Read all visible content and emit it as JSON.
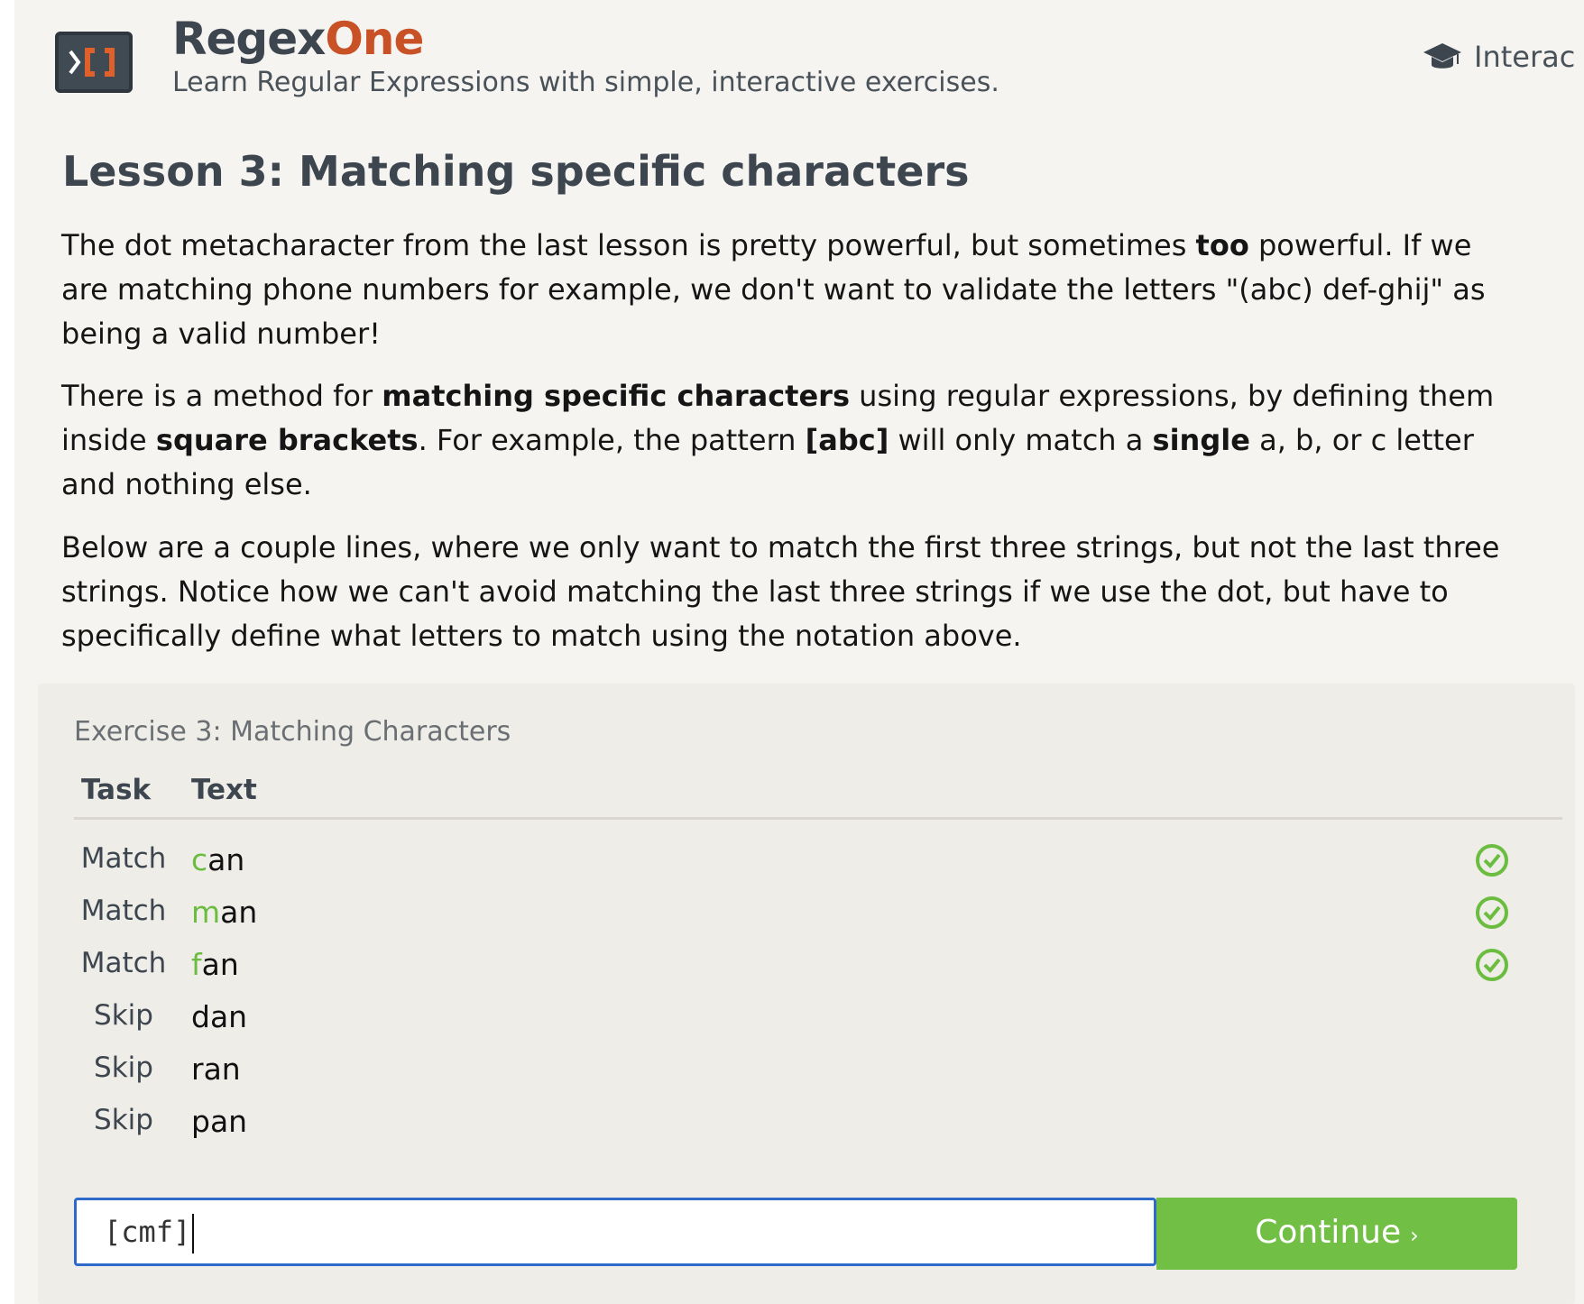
{
  "header": {
    "brand_part1": "Regex",
    "brand_part2": "One",
    "tagline": "Learn Regular Expressions with simple, interactive exercises.",
    "nav_link": "Interac",
    "logo_icon": "regex-bracket-logo",
    "nav_icon": "graduation-cap-icon"
  },
  "lesson": {
    "title": "Lesson 3: Matching specific characters",
    "p1": {
      "a": "The dot metacharacter from the last lesson is pretty powerful, but sometimes ",
      "b": "too",
      "c": " powerful. If we are matching phone numbers for example, we don't want to validate the letters \"(abc) def-ghij\" as being a valid number!"
    },
    "p2": {
      "a": "There is a method for ",
      "b": "matching specific characters",
      "c": " using regular expressions, by defining them inside ",
      "d": "square brackets",
      "e": ". For example, the pattern ",
      "f": "[abc]",
      "g": " will only match a ",
      "h": "single",
      "i": " a, b, or c letter and nothing else."
    },
    "p3": "Below are a couple lines, where we only want to match the first three strings, but not the last three strings. Notice how we can't avoid matching the last three strings if we use the dot, but have to specifically define what letters to match using the notation above."
  },
  "exercise": {
    "title": "Exercise 3: Matching Characters",
    "col_task": "Task",
    "col_text": "Text",
    "rows": [
      {
        "task": "Match",
        "hl": "c",
        "rest": "an",
        "done": true
      },
      {
        "task": "Match",
        "hl": "m",
        "rest": "an",
        "done": true
      },
      {
        "task": "Match",
        "hl": "f",
        "rest": "an",
        "done": true
      },
      {
        "task": "Skip",
        "hl": "",
        "rest": "dan",
        "done": false
      },
      {
        "task": "Skip",
        "hl": "",
        "rest": "ran",
        "done": false
      },
      {
        "task": "Skip",
        "hl": "",
        "rest": "pan",
        "done": false
      }
    ],
    "input_value": "[cmf]",
    "continue_label": "Continue",
    "continue_chevron": "›"
  },
  "colors": {
    "accent_orange": "#c85126",
    "match_green": "#6bbd3f",
    "button_green": "#72bf45",
    "input_border_blue": "#2e6acb"
  }
}
